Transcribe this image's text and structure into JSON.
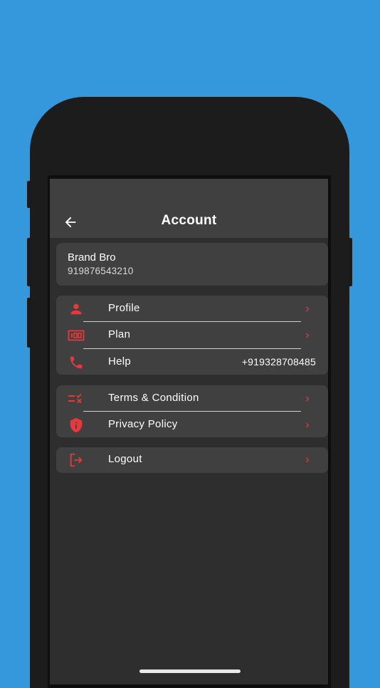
{
  "header": {
    "title": "Account"
  },
  "user": {
    "name": "Brand Bro",
    "phone": "919876543210"
  },
  "group1": [
    {
      "label": "Profile",
      "icon": "person-icon"
    },
    {
      "label": "Plan",
      "icon": "plan-icon"
    },
    {
      "label": "Help",
      "icon": "phone-icon",
      "value": "+919328708485"
    }
  ],
  "group2": [
    {
      "label": "Terms & Condition",
      "icon": "checklist-icon"
    },
    {
      "label": "Privacy Policy",
      "icon": "shield-icon"
    }
  ],
  "group3": [
    {
      "label": "Logout",
      "icon": "logout-icon"
    }
  ],
  "colors": {
    "background": "#3598dc",
    "accent": "#e8383b",
    "appbar": "#404040",
    "surface": "#2e2e2e",
    "card": "#404040"
  }
}
